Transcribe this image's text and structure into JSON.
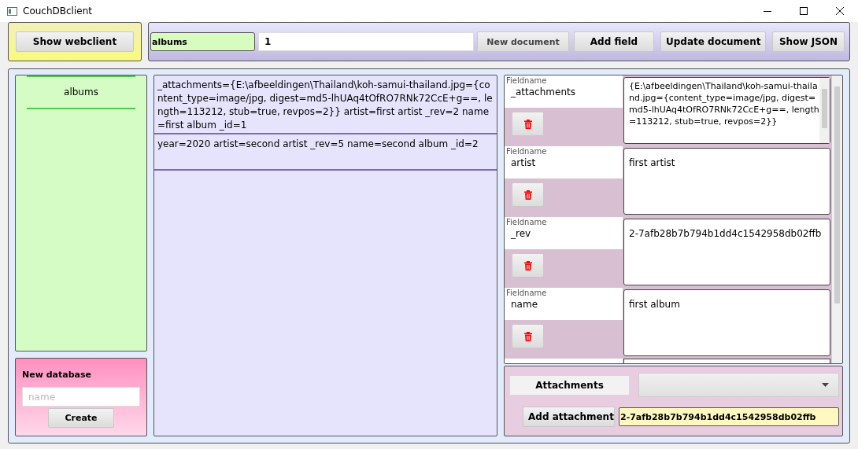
{
  "window": {
    "title": "CouchDBclient"
  },
  "toolbar": {
    "webclient_button": "Show webclient",
    "database_field": "albums",
    "id_field": "1",
    "buttons": [
      {
        "label": "New document",
        "disabled": true
      },
      {
        "label": "Add field",
        "disabled": false
      },
      {
        "label": "Update document",
        "disabled": false
      },
      {
        "label": "Show JSON",
        "disabled": false
      }
    ]
  },
  "databases": [
    {
      "name": "albums",
      "selected": true
    }
  ],
  "new_database": {
    "title": "New database",
    "placeholder": "name",
    "button": "Create"
  },
  "documents": [
    {
      "text": "_attachments={E:\\afbeeldingen\\Thailand\\koh-samui-thailand.jpg={content_type=image/jpg, digest=md5-lhUAq4tOfRO7RNk72CcE+g==, length=113212, stub=true, revpos=2}} artist=first artist _rev=2 name=first album _id=1",
      "selected": false
    },
    {
      "text": "year=2020 artist=second artist _rev=5 name=second album _id=2",
      "selected": false
    }
  ],
  "fields": [
    {
      "label": "Fieldname",
      "name": "_attachments",
      "value": "{E:\\afbeeldingen\\Thailand\\koh-samui-thailand.jpg={content_type=image/jpg, digest=md5-lhUAq4tOfRO7RNk72CcE+g==, length=113212, stub=true, revpos=2}}"
    },
    {
      "label": "Fieldname",
      "name": "artist",
      "value": "first artist"
    },
    {
      "label": "Fieldname",
      "name": "_rev",
      "value": "2-7afb28b7b794b1dd4c1542958db02ffb"
    },
    {
      "label": "Fieldname",
      "name": "name",
      "value": "first album"
    }
  ],
  "attachments": {
    "label": "Attachments",
    "button": "Add attachment",
    "revision": "2-7afb28b7b794b1dd4c1542958db02ffb"
  }
}
